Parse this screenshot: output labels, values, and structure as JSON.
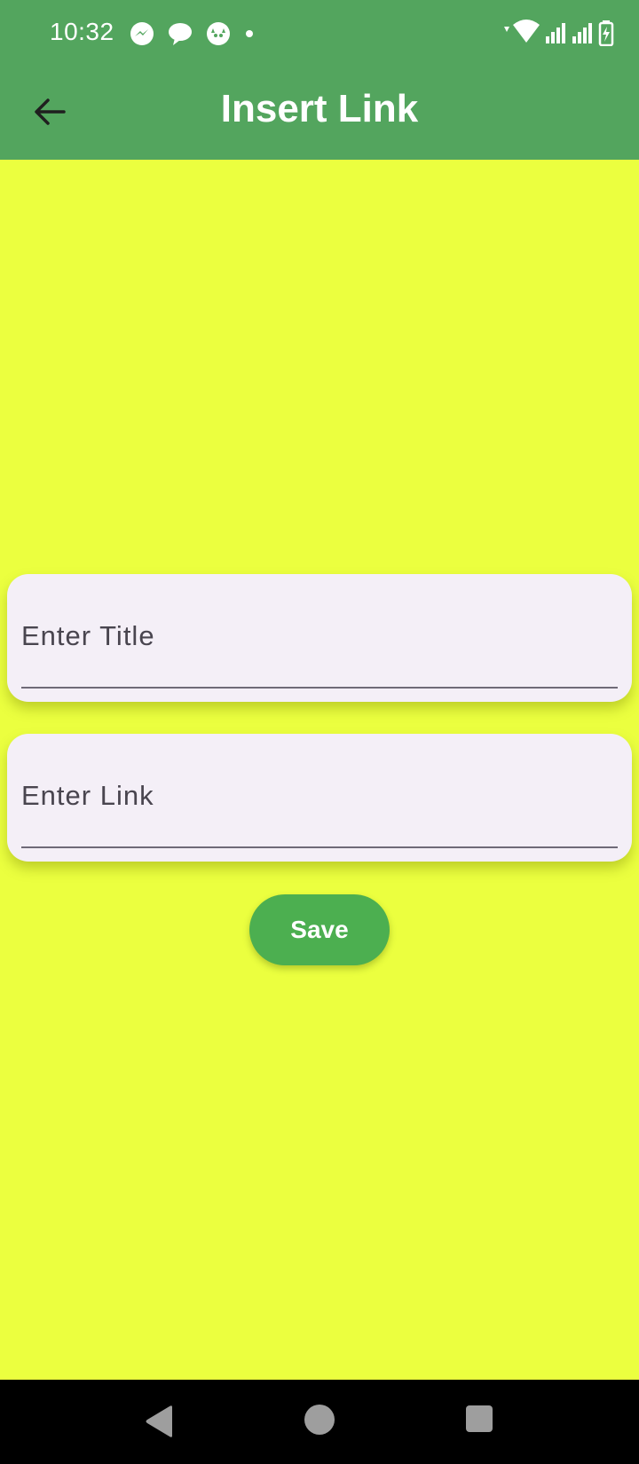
{
  "status_bar": {
    "time": "10:32",
    "notification_icons": [
      "messenger-icon",
      "chat-bubble-icon",
      "cat-face-icon",
      "dot-icon"
    ],
    "system_icons": [
      "wifi-icon",
      "signal-icon",
      "signal-icon-2",
      "battery-charging-icon"
    ]
  },
  "app_bar": {
    "title": "Insert Link",
    "back_icon": "arrow-left-icon",
    "color": "#53a55e"
  },
  "form": {
    "title_field": {
      "label": "Enter Title",
      "value": ""
    },
    "link_field": {
      "label": "Enter Link",
      "value": ""
    },
    "save_label": "Save"
  },
  "nav_bar": {
    "buttons": [
      "back-triangle-icon",
      "home-circle-icon",
      "recents-square-icon"
    ]
  },
  "colors": {
    "background": "#ebff3f",
    "field_background": "#f4eff7",
    "save_button": "#4caf50"
  }
}
